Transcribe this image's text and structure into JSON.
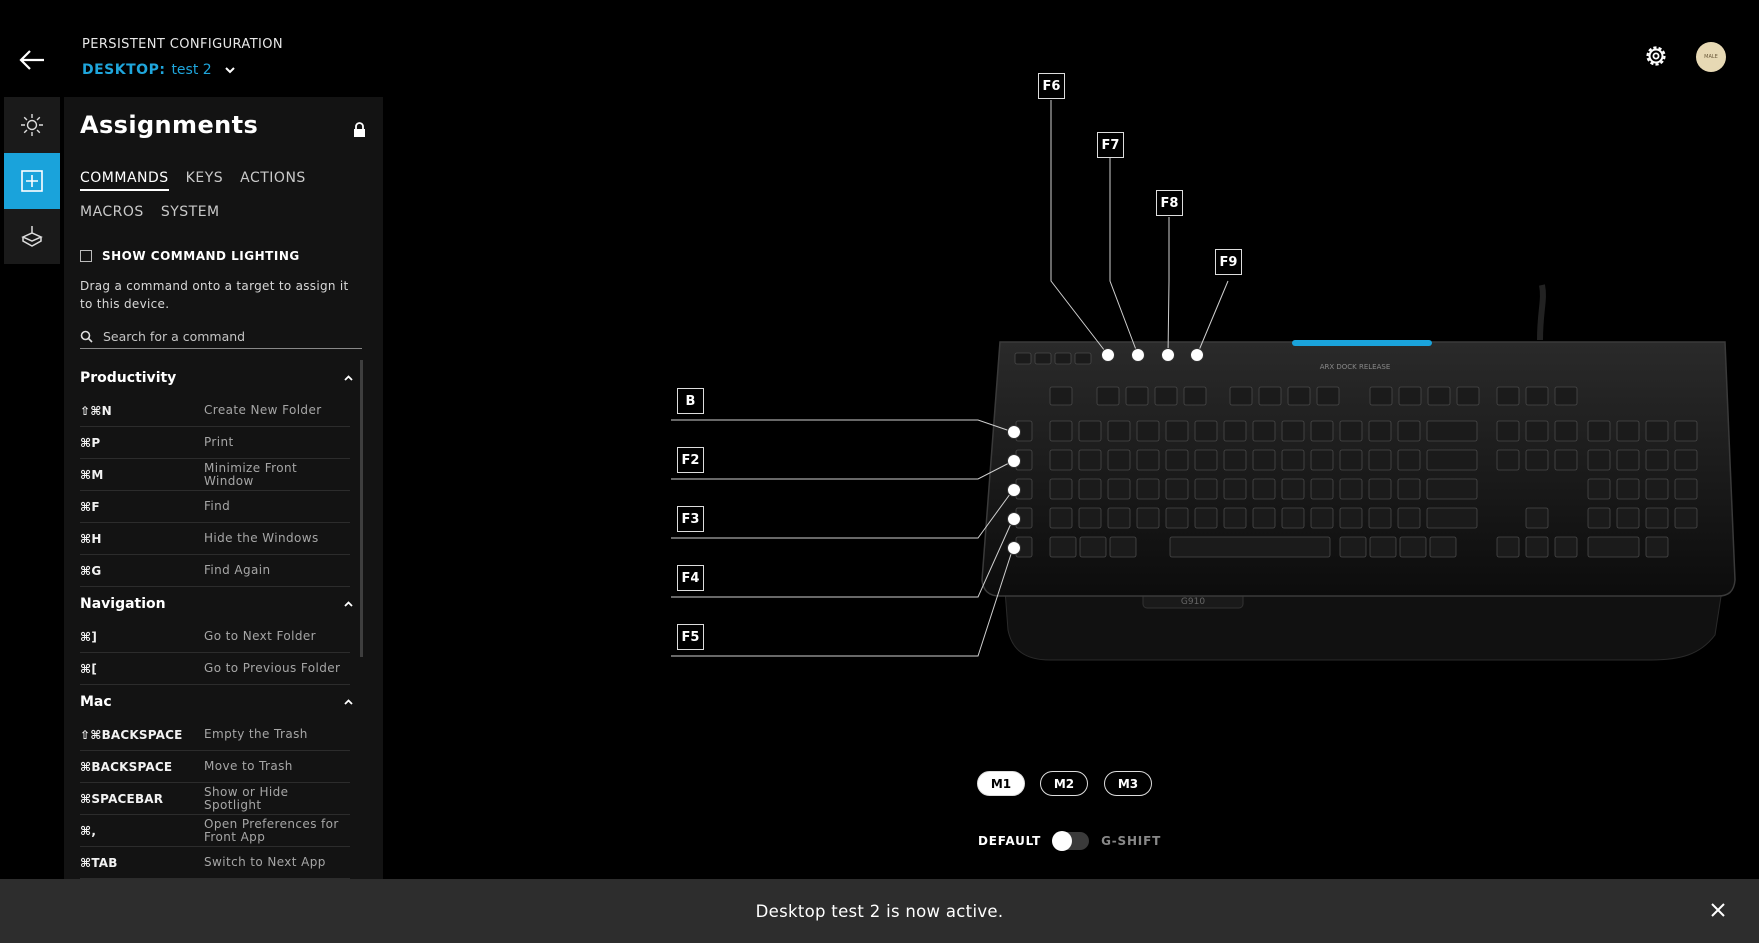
{
  "header": {
    "title": "PERSISTENT CONFIGURATION",
    "profile_prefix": "DESKTOP:",
    "profile_name": "test 2",
    "avatar_text": "MALE"
  },
  "rail": {
    "items": [
      {
        "icon": "sun-icon",
        "name": "lighting"
      },
      {
        "icon": "plus-square-icon",
        "name": "assignments",
        "active": true
      },
      {
        "icon": "keyboard-icon",
        "name": "device"
      }
    ]
  },
  "assignments": {
    "title": "Assignments",
    "tabs_row1": [
      "COMMANDS",
      "KEYS",
      "ACTIONS"
    ],
    "tabs_row2": [
      "MACROS",
      "SYSTEM"
    ],
    "active_tab": "COMMANDS",
    "show_lighting_label": "SHOW COMMAND LIGHTING",
    "hint": "Drag a command onto a target to assign it to this device.",
    "search_placeholder": "Search for a command",
    "categories": [
      {
        "name": "Productivity",
        "commands": [
          {
            "key": "⇧⌘N",
            "label": "Create New Folder"
          },
          {
            "key": "⌘P",
            "label": "Print"
          },
          {
            "key": "⌘M",
            "label": "Minimize Front Window"
          },
          {
            "key": "⌘F",
            "label": "Find"
          },
          {
            "key": "⌘H",
            "label": "Hide the Windows"
          },
          {
            "key": "⌘G",
            "label": "Find Again"
          }
        ]
      },
      {
        "name": "Navigation",
        "commands": [
          {
            "key": "⌘]",
            "label": "Go to Next Folder"
          },
          {
            "key": "⌘[",
            "label": "Go to Previous Folder"
          }
        ]
      },
      {
        "name": "Mac",
        "commands": [
          {
            "key": "⇧⌘BACKSPACE",
            "label": "Empty the Trash"
          },
          {
            "key": "⌘BACKSPACE",
            "label": "Move to Trash"
          },
          {
            "key": "⌘SPACEBAR",
            "label": "Show or Hide Spotlight"
          },
          {
            "key": "⌘,",
            "label": "Open Preferences for Front App"
          },
          {
            "key": "⌘TAB",
            "label": "Switch to Next App"
          }
        ]
      }
    ]
  },
  "callouts_top": [
    "F6",
    "F7",
    "F8",
    "F9"
  ],
  "callouts_left": [
    "B",
    "F2",
    "F3",
    "F4",
    "F5"
  ],
  "keyboard": {
    "arx_label": "ARX DOCK RELEASE",
    "model": "G910"
  },
  "memory_modes": [
    "M1",
    "M2",
    "M3"
  ],
  "active_mode": "M1",
  "shift": {
    "left": "DEFAULT",
    "right": "G-SHIFT"
  },
  "toast": {
    "message": "Desktop test 2 is now active."
  },
  "colors": {
    "accent": "#1aa3db",
    "panel": "#131313",
    "toast": "#2d2d2d"
  }
}
